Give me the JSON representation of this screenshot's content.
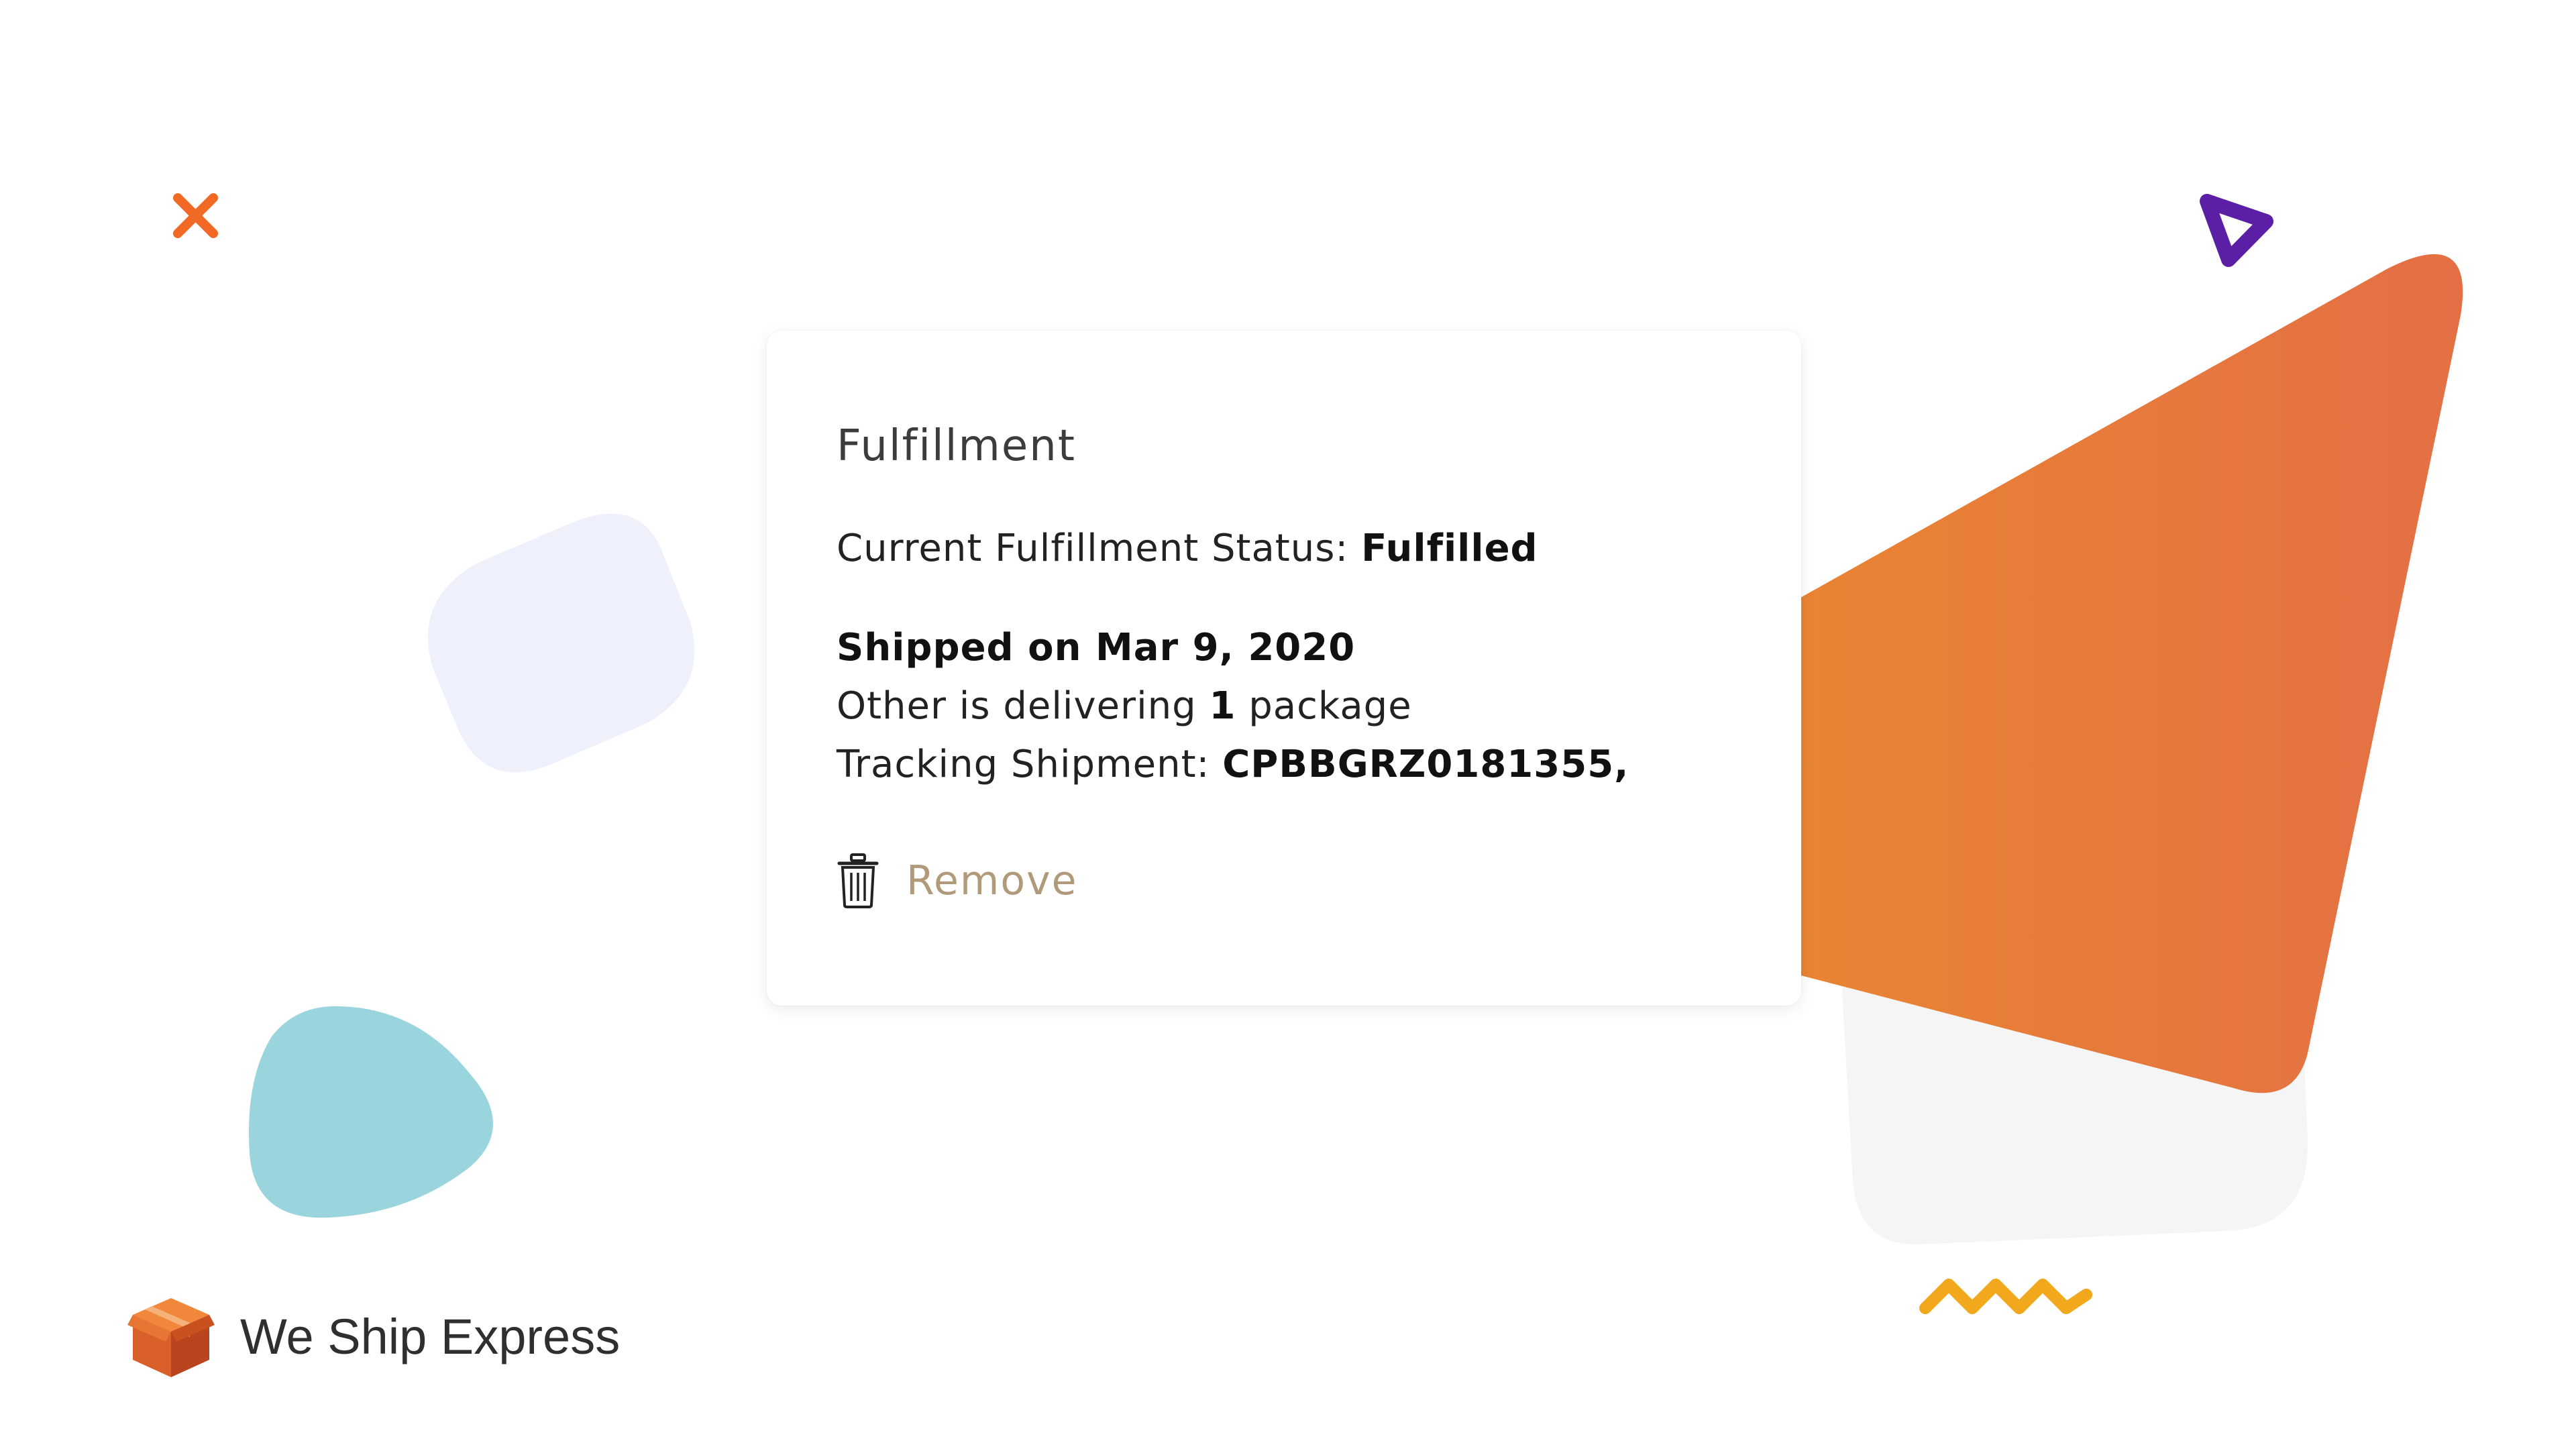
{
  "card": {
    "title": "Fulfillment",
    "status_label": "Current Fulfillment Status: ",
    "status_value": "Fulfilled",
    "shipped_text": "Shipped on Mar 9, 2020",
    "delivering_prefix": "Other is delivering ",
    "delivering_count": "1",
    "delivering_suffix": " package",
    "tracking_label": "Tracking Shipment: ",
    "tracking_value": "CPBBGRZ0181355,",
    "remove_label": "Remove",
    "remove_icon": "trash-icon"
  },
  "brand": {
    "name": "We Ship Express",
    "logo_icon": "box-icon"
  },
  "colors": {
    "accent_orange": "#e8772f",
    "remove_text": "#b09a7a",
    "purple_triangle": "#5b1fa6",
    "teal_blob": "#9ad5de",
    "lavender_square": "#eef1fb",
    "yellow_zigzag": "#f2a81d",
    "x_mark": "#f06a25"
  }
}
